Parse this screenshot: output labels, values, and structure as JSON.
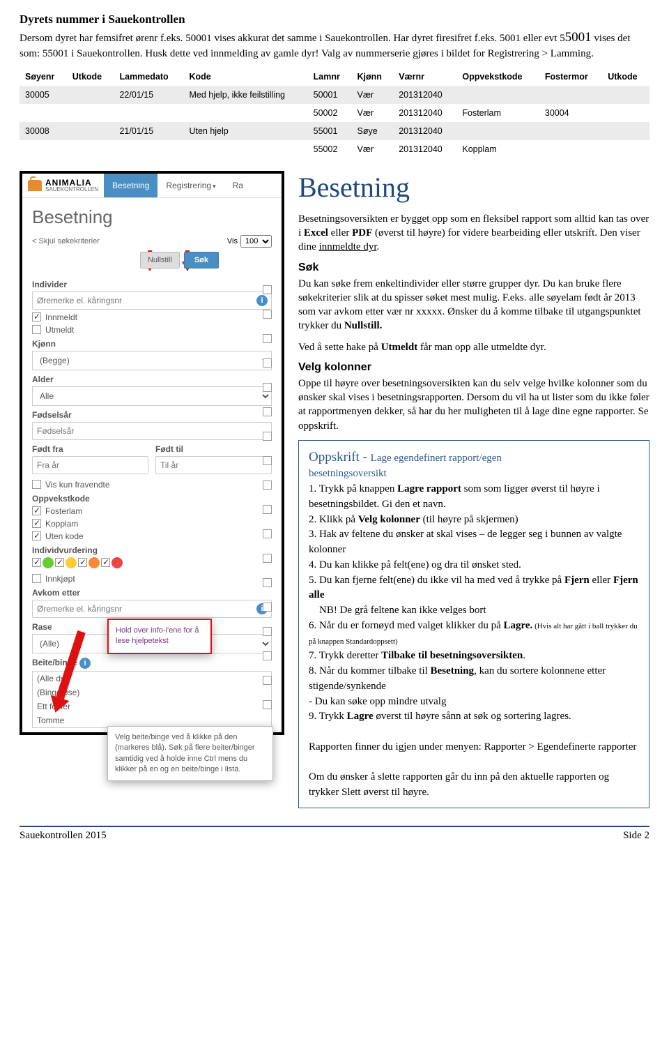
{
  "header": {
    "title": "Dyrets nummer i Sauekontrollen",
    "p1a": "Dersom dyret har femsifret ørenr f.eks. 50001 vises akkurat det samme i Sauekontrollen. Har dyret firesifret f.eks. 5001 eller evt 5",
    "p1b": "5001",
    "p1c": " vises det som: 55001 i Sauekontrollen. Husk dette ved innmelding av gamle dyr! Valg av nummerserie gjøres i bildet for Registrering > Lamming."
  },
  "table": {
    "headers": [
      "Søyenr",
      "Utkode",
      "Lammedato",
      "Kode",
      "Lamnr",
      "Kjønn",
      "Værnr",
      "Oppvekstkode",
      "Fostermor",
      "Utkode"
    ],
    "rows": [
      [
        "30005",
        "",
        "22/01/15",
        "Med hjelp, ikke feilstilling",
        "50001",
        "Vær",
        "201312040",
        "",
        "",
        ""
      ],
      [
        "",
        "",
        "",
        "",
        "50002",
        "Vær",
        "201312040",
        "Fosterlam",
        "30004",
        ""
      ],
      [
        "30008",
        "",
        "21/01/15",
        "Uten hjelp",
        "55001",
        "Søye",
        "201312040",
        "",
        "",
        ""
      ],
      [
        "",
        "",
        "",
        "",
        "55002",
        "Vær",
        "201312040",
        "Kopplam",
        "",
        ""
      ]
    ]
  },
  "ui": {
    "brand": "ANIMALIA",
    "brand_sub": "SAUEKONTROLLEN",
    "tab_besetning": "Besetning",
    "tab_registrering": "Registrering",
    "tab_rap": "Ra",
    "page_title": "Besetning",
    "skjul": "< Skjul søkekriterier",
    "vis_label": "Vis",
    "vis_value": "100",
    "btn_nullstill": "Nullstill",
    "btn_sok": "Søk",
    "lbl_individer": "Individer",
    "ph_oremerke": "Øremerke el. kåringsnr",
    "chk_innmeldt": "Innmeldt",
    "chk_utmeldt": "Utmeldt",
    "lbl_kjonn": "Kjønn",
    "sel_begge": "(Begge)",
    "lbl_alder": "Alder",
    "sel_alle": "Alle",
    "lbl_fodsaar": "Fødselsår",
    "ph_fodsaar": "Fødselsår",
    "lbl_fra": "Født fra",
    "lbl_til": "Født til",
    "ph_fra": "Fra år",
    "ph_til": "Til år",
    "chk_fravendte": "Vis kun fravendte",
    "lbl_oppvekst": "Oppvekstkode",
    "chk_fosterlam": "Fosterlam",
    "chk_kopplam": "Kopplam",
    "chk_utenkode": "Uten kode",
    "lbl_indvurd": "Individvurdering",
    "chk_innkjopt": "Innkjøpt",
    "lbl_avkom": "Avkom etter",
    "lbl_rase": "Rase",
    "sel_alle2": "(Alle)",
    "lbl_beite": "Beite/binge",
    "ml1": "(Alle dyr)",
    "ml2": "(Bingeløse)",
    "ml3": "Ett foster",
    "ml4": "Tomme",
    "callout1": "Hold over info-i'ene for å lese hjelpetekst",
    "callout2": "Velg beite/binge ved å klikke på den (markeres blå). Søk på flere beiter/binger samtidig ved å holde inne Ctrl mens du klikker på en og en beite/binge i lista."
  },
  "right": {
    "h": "Besetning",
    "p1": "Besetningsoversikten er bygget opp som en fleksibel rapport som alltid kan tas over i ",
    "p1b": "Excel",
    "p1c": " eller ",
    "p1d": "PDF",
    "p1e": " (øverst til høyre) for videre bearbeiding eller utskrift. Den viser dine ",
    "p1f": "innmeldte dyr",
    "p1g": ".",
    "sok_h": "Søk",
    "sok_p1": "Du kan søke frem enkeltindivider eller større grupper dyr. Du kan bruke flere søkekriterier slik at du spisser søket mest mulig. F.eks. alle søyelam født år 2013 som var avkom etter vær nr xxxxx. Ønsker du å komme tilbake til utgangspunktet trykker du ",
    "sok_b": "Nullstill.",
    "ut_p": "Ved å sette hake på ",
    "ut_b": "Utmeldt",
    "ut_p2": " får man opp alle utmeldte dyr.",
    "vk_h": "Velg kolonner",
    "vk_p": "Oppe til høyre over besetningsoversikten kan du selv velge hvilke kolonner som du ønsker skal vises i besetningsrapporten. Dersom du vil ha ut lister som du ikke føler at rapportmenyen dekker, så har du her muligheten til å lage dine egne rapporter. Se oppskrift.",
    "rb_title": "Oppskrift - ",
    "rb_title2a": "Lage egendefinert rapport/egen",
    "rb_title2b": "besetningsoversikt",
    "l1a": "1. Trykk på knappen ",
    "l1b": "Lagre rapport",
    "l1c": " som som ligger øverst til høyre i besetningsbildet. Gi den et navn.",
    "l2a": "2. Klikk på ",
    "l2b": "Velg kolonner",
    "l2c": " (til høyre på skjermen)",
    "l3": "3. Hak av feltene du ønsker at skal vises – de legger seg i bunnen av valgte kolonner",
    "l4": "4. Du kan klikke på felt(ene) og dra til ønsket sted.",
    "l5a": "5. Du kan fjerne felt(ene) du ikke vil ha med ved å trykke på ",
    "l5b": "Fjern",
    "l5c": " eller ",
    "l5d": "Fjern alle",
    "l5nb": "    NB! De grå feltene kan ikke velges bort",
    "l6a": "6. Når du er fornøyd med valget klikker du på ",
    "l6b": "Lagre.",
    "l6c": " (Hvis alt har gått i ball trykker du på knappen Standardoppsett)",
    "l7a": "7. Trykk deretter ",
    "l7b": "Tilbake til besetningsoversikten",
    "l7c": ".",
    "l8a": "8. Når du kommer tilbake til ",
    "l8b": "Besetning",
    "l8c": ", kan du sortere kolonnene etter stigende/synkende",
    "l8d": "- Du kan søke opp mindre utvalg",
    "l9a": "9. Trykk ",
    "l9b": "Lagre",
    "l9c": " øverst til høyre sånn at søk og sortering lagres.",
    "rb_p1": "Rapporten finner du igjen under menyen: Rapporter > Egendefinerte rapporter",
    "rb_p2": "Om du ønsker å slette rapporten går du inn på den aktuelle rapporten og trykker Slett øverst til høyre."
  },
  "footer": {
    "left": "Sauekontrollen 2015",
    "right": "Side 2"
  }
}
